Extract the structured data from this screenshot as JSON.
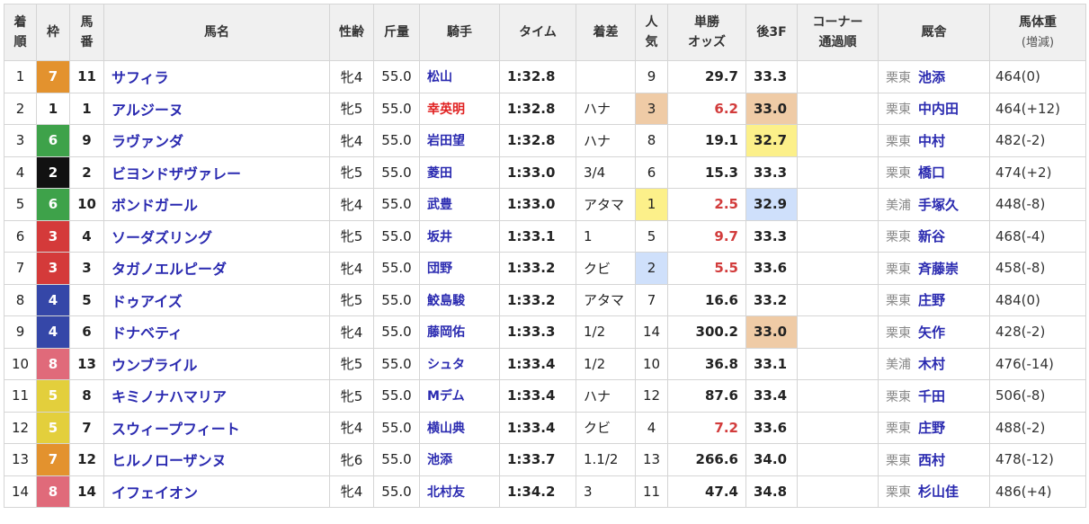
{
  "headers": {
    "finish": [
      "着",
      "順"
    ],
    "waku": "枠",
    "num": [
      "馬",
      "番"
    ],
    "name": "馬名",
    "sexage": "性齢",
    "weight_carried": "斤量",
    "jockey": "騎手",
    "time": "タイム",
    "margin": "着差",
    "popularity": [
      "人",
      "気"
    ],
    "odds": [
      "単勝",
      "オッズ"
    ],
    "last3f": "後3F",
    "corner": [
      "コーナー",
      "通過順"
    ],
    "stable": "厩舎",
    "body_weight": [
      "馬体重",
      "(増減)"
    ]
  },
  "colors": {
    "waku": {
      "1": "#ffffff",
      "2": "#111111",
      "3": "#d43a3a",
      "4": "#3547a8",
      "5": "#e3cf3c",
      "6": "#3ea24a",
      "7": "#e3922e",
      "8": "#e06a7a"
    },
    "rank1": "#fcf08a",
    "rank2": "#cfe0fb",
    "rank3": "#efcba6"
  },
  "rows": [
    {
      "pos": "1",
      "waku": "7",
      "num": "11",
      "name": "サフィラ",
      "sex": "牝4",
      "kg": "55.0",
      "jockey": "松山",
      "fem": false,
      "time": "1:32.8",
      "margin": "",
      "pop": "9",
      "odds": "29.7",
      "f3": "33.3",
      "corner": "",
      "region": "栗東",
      "trainer": "池添",
      "bw": "464(0)"
    },
    {
      "pos": "2",
      "waku": "1",
      "num": "1",
      "name": "アルジーヌ",
      "sex": "牝5",
      "kg": "55.0",
      "jockey": "幸英明",
      "fem": true,
      "time": "1:32.8",
      "margin": "ハナ",
      "pop": "3",
      "odds": "6.2",
      "f3": "33.0",
      "corner": "",
      "region": "栗東",
      "trainer": "中内田",
      "bw": "464(+12)",
      "popRank": 3,
      "f3Rank": 3
    },
    {
      "pos": "3",
      "waku": "6",
      "num": "9",
      "name": "ラヴァンダ",
      "sex": "牝4",
      "kg": "55.0",
      "jockey": "岩田望",
      "fem": false,
      "time": "1:32.8",
      "margin": "ハナ",
      "pop": "8",
      "odds": "19.1",
      "f3": "32.7",
      "corner": "",
      "region": "栗東",
      "trainer": "中村",
      "bw": "482(-2)",
      "f3Rank": 1
    },
    {
      "pos": "4",
      "waku": "2",
      "num": "2",
      "name": "ビヨンドザヴァレー",
      "sex": "牝5",
      "kg": "55.0",
      "jockey": "菱田",
      "fem": false,
      "time": "1:33.0",
      "margin": "3/4",
      "pop": "6",
      "odds": "15.3",
      "f3": "33.3",
      "corner": "",
      "region": "栗東",
      "trainer": "橋口",
      "bw": "474(+2)"
    },
    {
      "pos": "5",
      "waku": "6",
      "num": "10",
      "name": "ボンドガール",
      "sex": "牝4",
      "kg": "55.0",
      "jockey": "武豊",
      "fem": false,
      "time": "1:33.0",
      "margin": "アタマ",
      "pop": "1",
      "odds": "2.5",
      "f3": "32.9",
      "corner": "",
      "region": "美浦",
      "trainer": "手塚久",
      "bw": "448(-8)",
      "popRank": 1,
      "f3Rank": 2
    },
    {
      "pos": "6",
      "waku": "3",
      "num": "4",
      "name": "ソーダズリング",
      "sex": "牝5",
      "kg": "55.0",
      "jockey": "坂井",
      "fem": false,
      "time": "1:33.1",
      "margin": "1",
      "pop": "5",
      "odds": "9.7",
      "f3": "33.3",
      "corner": "",
      "region": "栗東",
      "trainer": "新谷",
      "bw": "468(-4)"
    },
    {
      "pos": "7",
      "waku": "3",
      "num": "3",
      "name": "タガノエルピーダ",
      "sex": "牝4",
      "kg": "55.0",
      "jockey": "団野",
      "fem": false,
      "time": "1:33.2",
      "margin": "クビ",
      "pop": "2",
      "odds": "5.5",
      "f3": "33.6",
      "corner": "",
      "region": "栗東",
      "trainer": "斉藤崇",
      "bw": "458(-8)",
      "popRank": 2
    },
    {
      "pos": "8",
      "waku": "4",
      "num": "5",
      "name": "ドゥアイズ",
      "sex": "牝5",
      "kg": "55.0",
      "jockey": "鮫島駿",
      "fem": false,
      "time": "1:33.2",
      "margin": "アタマ",
      "pop": "7",
      "odds": "16.6",
      "f3": "33.2",
      "corner": "",
      "region": "栗東",
      "trainer": "庄野",
      "bw": "484(0)"
    },
    {
      "pos": "9",
      "waku": "4",
      "num": "6",
      "name": "ドナベティ",
      "sex": "牝4",
      "kg": "55.0",
      "jockey": "藤岡佑",
      "fem": false,
      "time": "1:33.3",
      "margin": "1/2",
      "pop": "14",
      "odds": "300.2",
      "f3": "33.0",
      "corner": "",
      "region": "栗東",
      "trainer": "矢作",
      "bw": "428(-2)",
      "f3Rank": 3
    },
    {
      "pos": "10",
      "waku": "8",
      "num": "13",
      "name": "ウンブライル",
      "sex": "牝5",
      "kg": "55.0",
      "jockey": "シュタ",
      "fem": false,
      "time": "1:33.4",
      "margin": "1/2",
      "pop": "10",
      "odds": "36.8",
      "f3": "33.1",
      "corner": "",
      "region": "美浦",
      "trainer": "木村",
      "bw": "476(-14)"
    },
    {
      "pos": "11",
      "waku": "5",
      "num": "8",
      "name": "キミノナハマリア",
      "sex": "牝5",
      "kg": "55.0",
      "jockey": "Mデム",
      "fem": false,
      "time": "1:33.4",
      "margin": "ハナ",
      "pop": "12",
      "odds": "87.6",
      "f3": "33.4",
      "corner": "",
      "region": "栗東",
      "trainer": "千田",
      "bw": "506(-8)"
    },
    {
      "pos": "12",
      "waku": "5",
      "num": "7",
      "name": "スウィープフィート",
      "sex": "牝4",
      "kg": "55.0",
      "jockey": "横山典",
      "fem": false,
      "time": "1:33.4",
      "margin": "クビ",
      "pop": "4",
      "odds": "7.2",
      "f3": "33.6",
      "corner": "",
      "region": "栗東",
      "trainer": "庄野",
      "bw": "488(-2)"
    },
    {
      "pos": "13",
      "waku": "7",
      "num": "12",
      "name": "ヒルノローザンヌ",
      "sex": "牝6",
      "kg": "55.0",
      "jockey": "池添",
      "fem": false,
      "time": "1:33.7",
      "margin": "1.1/2",
      "pop": "13",
      "odds": "266.6",
      "f3": "34.0",
      "corner": "",
      "region": "栗東",
      "trainer": "西村",
      "bw": "478(-12)"
    },
    {
      "pos": "14",
      "waku": "8",
      "num": "14",
      "name": "イフェイオン",
      "sex": "牝4",
      "kg": "55.0",
      "jockey": "北村友",
      "fem": false,
      "time": "1:34.2",
      "margin": "3",
      "pop": "11",
      "odds": "47.4",
      "f3": "34.8",
      "corner": "",
      "region": "栗東",
      "trainer": "杉山佳",
      "bw": "486(+4)"
    }
  ]
}
